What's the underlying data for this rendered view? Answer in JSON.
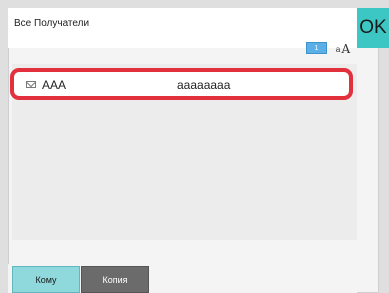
{
  "window": {
    "title": "Все Получатели",
    "ok_label": "OK"
  },
  "toolbar": {
    "page_number": "1",
    "sort_small": "a",
    "sort_big": "A"
  },
  "recipients": [
    {
      "name": "AAA",
      "address": "aaaaaaaa",
      "icon": "envelope-icon",
      "selected": true
    }
  ],
  "tabs": [
    {
      "label": "Кому",
      "active": true
    },
    {
      "label": "Копия",
      "active": false
    }
  ],
  "colors": {
    "ok_button": "#3cc7c4",
    "selection_border": "#e2303d",
    "active_tab": "#8fd9dc",
    "inactive_tab": "#6b6b6b",
    "page_indicator": "#5ab0e6"
  }
}
